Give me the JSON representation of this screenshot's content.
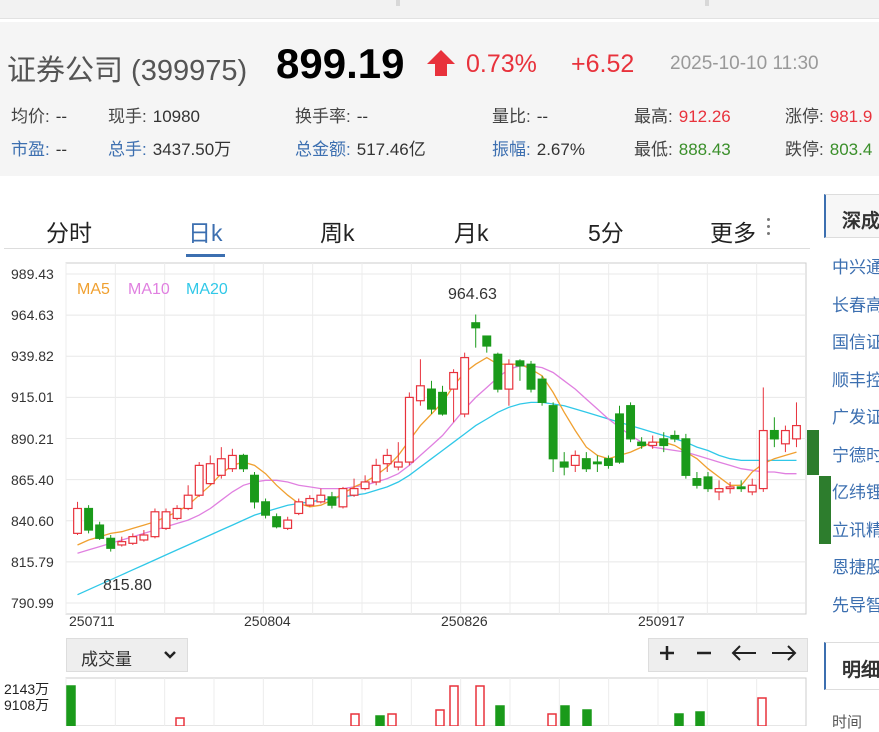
{
  "header": {
    "name": "证券公司 (399975)",
    "price": "899.19",
    "change_pct": "0.73%",
    "change_abs": "+6.52",
    "datetime": "2025-10-10 11:30"
  },
  "stats_row1": [
    {
      "key": "均价:",
      "val": "--",
      "kcolor": "",
      "vcolor": ""
    },
    {
      "key": "现手:",
      "val": "10980",
      "kcolor": "",
      "vcolor": ""
    },
    {
      "key": "换手率:",
      "val": "--",
      "kcolor": "",
      "vcolor": ""
    },
    {
      "key": "量比:",
      "val": "--",
      "kcolor": "",
      "vcolor": ""
    },
    {
      "key": "最高:",
      "val": "912.26",
      "kcolor": "",
      "vcolor": "red"
    },
    {
      "key": "涨停:",
      "val": "981.9",
      "kcolor": "",
      "vcolor": "red"
    }
  ],
  "stats_row2": [
    {
      "key": "市盈:",
      "val": "--",
      "kcolor": "blue",
      "vcolor": ""
    },
    {
      "key": "总手:",
      "val": "3437.50万",
      "kcolor": "blue",
      "vcolor": ""
    },
    {
      "key": "总金额:",
      "val": "517.46亿",
      "kcolor": "blue",
      "vcolor": ""
    },
    {
      "key": "振幅:",
      "val": "2.67%",
      "kcolor": "blue",
      "vcolor": ""
    },
    {
      "key": "最低:",
      "val": "888.43",
      "kcolor": "",
      "vcolor": "green"
    },
    {
      "key": "跌停:",
      "val": "803.4",
      "kcolor": "",
      "vcolor": "green"
    }
  ],
  "tabs": [
    "分时",
    "日k",
    "周k",
    "月k",
    "5分",
    "更多"
  ],
  "active_tab": "日k",
  "volume_selector": "成交量",
  "volume_axis": [
    "2143万",
    "9108万"
  ],
  "sidebar": {
    "title": "深成",
    "items": [
      "中兴通",
      "长春高",
      "国信证",
      "顺丰控",
      "广发证",
      "宁德时",
      "亿纬锂",
      "立讯精",
      "恩捷股",
      "先导智"
    ],
    "title2": "明细",
    "time_label": "时间"
  },
  "colors": {
    "up": "#e8323c",
    "down": "#1a9a1a",
    "ma5": "#f0a030",
    "ma10": "#e080e0",
    "ma20": "#30c8e8",
    "accent": "#3c6fb0"
  },
  "chart_data": {
    "type": "candlestick",
    "y_ticks": [
      "989.43",
      "964.63",
      "939.82",
      "915.01",
      "890.21",
      "865.40",
      "840.60",
      "815.79",
      "790.99"
    ],
    "ylim": [
      790.99,
      989.43
    ],
    "x_ticks": [
      "250711",
      "250804",
      "250826",
      "250917"
    ],
    "legend": [
      "MA5",
      "MA10",
      "MA20"
    ],
    "annotations": {
      "max": "964.63",
      "min": "815.80"
    },
    "candles": [
      [
        833,
        848,
        852,
        832
      ],
      [
        848,
        835,
        850,
        833
      ],
      [
        838,
        830,
        840,
        829
      ],
      [
        830,
        824,
        832,
        822
      ],
      [
        826,
        828,
        831,
        825
      ],
      [
        827,
        831,
        833,
        826
      ],
      [
        829,
        832,
        835,
        828
      ],
      [
        831,
        846,
        848,
        830
      ],
      [
        836,
        846,
        848,
        835
      ],
      [
        842,
        848,
        850,
        841
      ],
      [
        848,
        856,
        862,
        847
      ],
      [
        856,
        874,
        876,
        855
      ],
      [
        863,
        875,
        880,
        862
      ],
      [
        868,
        878,
        885,
        866
      ],
      [
        872,
        880,
        884,
        870
      ],
      [
        880,
        872,
        881,
        870
      ],
      [
        868,
        852,
        870,
        848
      ],
      [
        852,
        844,
        854,
        842
      ],
      [
        843,
        837,
        845,
        836
      ],
      [
        836,
        841,
        843,
        835
      ],
      [
        845,
        852,
        854,
        844
      ],
      [
        850,
        854,
        856,
        849
      ],
      [
        852,
        856,
        860,
        851
      ],
      [
        855,
        850,
        858,
        848
      ],
      [
        849,
        860,
        861,
        848
      ],
      [
        856,
        860,
        866,
        855
      ],
      [
        860,
        864,
        868,
        859
      ],
      [
        864,
        874,
        878,
        862
      ],
      [
        875,
        880,
        884,
        870
      ],
      [
        873,
        876,
        888,
        871
      ],
      [
        876,
        915,
        918,
        874
      ],
      [
        913,
        922,
        938,
        910
      ],
      [
        920,
        908,
        925,
        905
      ],
      [
        918,
        905,
        922,
        904
      ],
      [
        920,
        930,
        932,
        900
      ],
      [
        905,
        939,
        942,
        903
      ],
      [
        960,
        957,
        965,
        945
      ],
      [
        952,
        946,
        950,
        942
      ],
      [
        941,
        920,
        942,
        918
      ],
      [
        920,
        935,
        938,
        910
      ],
      [
        937,
        934,
        938,
        925
      ],
      [
        935,
        920,
        937,
        918
      ],
      [
        926,
        912,
        928,
        910
      ],
      [
        910,
        878,
        912,
        870
      ],
      [
        876,
        873,
        882,
        868
      ],
      [
        874,
        880,
        883,
        870
      ],
      [
        878,
        872,
        882,
        870
      ],
      [
        876,
        875,
        880,
        870
      ],
      [
        878,
        874,
        880,
        872
      ],
      [
        905,
        876,
        910,
        875
      ],
      [
        910,
        890,
        912,
        888
      ],
      [
        888,
        886,
        891,
        884
      ],
      [
        886,
        888,
        892,
        884
      ],
      [
        890,
        886,
        894,
        882
      ],
      [
        892,
        890,
        895,
        888
      ],
      [
        890,
        868,
        893,
        866
      ],
      [
        866,
        862,
        870,
        860
      ],
      [
        867,
        860,
        870,
        858
      ],
      [
        858,
        860,
        865,
        853
      ],
      [
        860,
        861,
        864,
        857
      ],
      [
        861,
        860,
        865,
        858
      ],
      [
        858,
        862,
        866,
        856
      ],
      [
        860,
        895,
        921,
        858
      ],
      [
        895,
        890,
        903,
        885
      ],
      [
        887,
        895,
        898,
        882
      ],
      [
        890,
        898,
        912,
        885
      ]
    ],
    "ma5": [
      826,
      829,
      831,
      833,
      834,
      836,
      838,
      840,
      843,
      846,
      850,
      856,
      862,
      869,
      874,
      876,
      874,
      869,
      862,
      856,
      851,
      849,
      850,
      853,
      857,
      861,
      864,
      868,
      873,
      880,
      889,
      898,
      905,
      912,
      922,
      930,
      935,
      939,
      935,
      935,
      935,
      932,
      928,
      918,
      906,
      895,
      885,
      880,
      878,
      880,
      882,
      885,
      888,
      888,
      886,
      882,
      878,
      872,
      867,
      862,
      862,
      870,
      875,
      878,
      880,
      882
    ],
    "ma10": [
      821,
      823,
      825,
      827,
      829,
      831,
      833,
      835,
      837,
      839,
      841,
      844,
      848,
      853,
      858,
      862,
      864,
      865,
      865,
      864,
      862,
      861,
      860,
      860,
      860,
      861,
      862,
      864,
      866,
      869,
      874,
      880,
      886,
      892,
      900,
      908,
      915,
      921,
      927,
      932,
      934,
      934,
      933,
      930,
      925,
      920,
      914,
      908,
      902,
      897,
      892,
      888,
      885,
      884,
      883,
      882,
      880,
      878,
      876,
      874,
      872,
      871,
      870,
      870,
      869,
      869
    ],
    "ma20": [
      796,
      799,
      802,
      805,
      808,
      811,
      814,
      817,
      820,
      823,
      826,
      829,
      832,
      835,
      838,
      841,
      844,
      846,
      848,
      850,
      851,
      852,
      853,
      854,
      855,
      856,
      857,
      859,
      861,
      864,
      868,
      873,
      878,
      883,
      888,
      893,
      898,
      902,
      906,
      909,
      911,
      912,
      912,
      911,
      910,
      908,
      906,
      904,
      902,
      900,
      898,
      896,
      894,
      892,
      890,
      888,
      885,
      883,
      880,
      878,
      877,
      877,
      877,
      877,
      877,
      877
    ],
    "volume": [
      {
        "v": 1.0,
        "up": false
      },
      {
        "v": 0.2,
        "up": true
      },
      {
        "v": 0.3,
        "up": true
      },
      {
        "v": 0.25,
        "up": false
      },
      {
        "v": 0.3,
        "up": true
      },
      {
        "v": 0.4,
        "up": true
      },
      {
        "v": 1.0,
        "up": true
      },
      {
        "v": 1.0,
        "up": true
      },
      {
        "v": 0.5,
        "up": false
      },
      {
        "v": 0.3,
        "up": true
      },
      {
        "v": 0.5,
        "up": false
      },
      {
        "v": 0.4,
        "up": false
      },
      {
        "v": 0.3,
        "up": false
      },
      {
        "v": 0.35,
        "up": false
      },
      {
        "v": 0.7,
        "up": true
      }
    ]
  }
}
